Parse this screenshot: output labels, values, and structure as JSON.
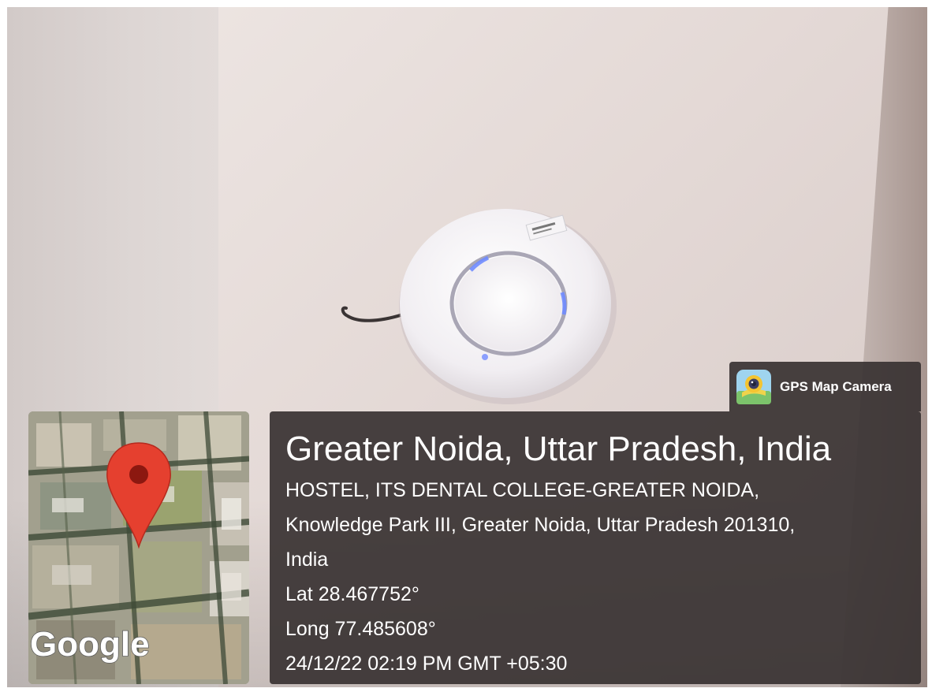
{
  "badge": {
    "app_name": "GPS Map Camera",
    "icon": "gps-map-camera-icon"
  },
  "location": {
    "title": "Greater Noida, Uttar Pradesh, India",
    "address_line_1": "HOSTEL, ITS DENTAL COLLEGE-GREATER NOIDA,",
    "address_line_2": "Knowledge Park III, Greater Noida, Uttar Pradesh 201310,",
    "address_line_3": "India",
    "latitude": "Lat 28.467752°",
    "longitude": "Long 77.485608°",
    "datetime": "24/12/22 02:19 PM GMT +05:30"
  },
  "map": {
    "provider_logo": "Google",
    "pin_color": "#e5402f",
    "icon": "map-pin-icon"
  },
  "colors": {
    "panel_bg": "#383232",
    "text": "#ffffff"
  }
}
